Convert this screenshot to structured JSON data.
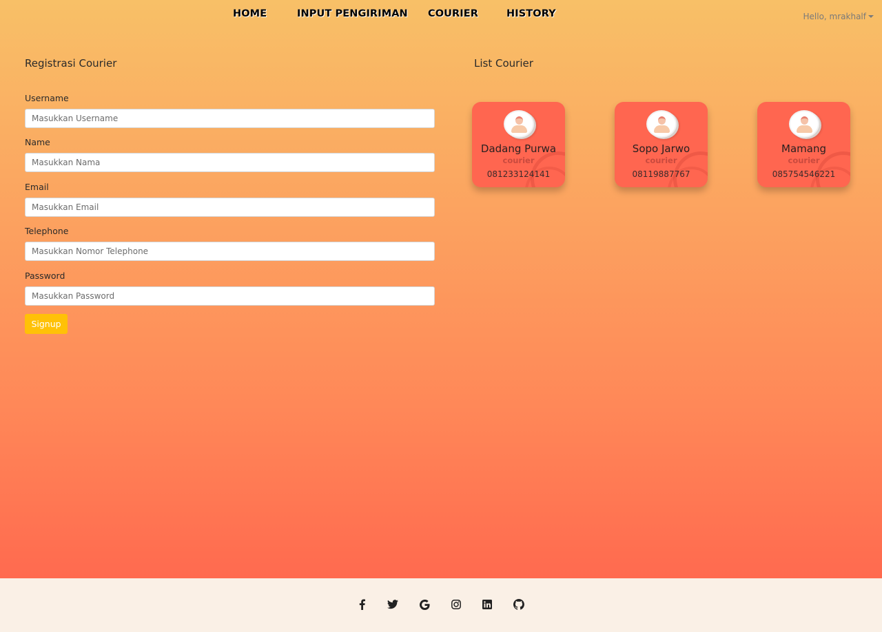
{
  "nav": {
    "items": [
      "HOME",
      "INPUT PENGIRIMAN",
      "COURIER",
      "HISTORY"
    ],
    "user_greeting": "Hello, mrakhalf"
  },
  "form": {
    "title": "Registrasi Courier",
    "fields": [
      {
        "label": "Username",
        "placeholder": "Masukkan Username",
        "value": ""
      },
      {
        "label": "Name",
        "placeholder": "Masukkan Nama",
        "value": ""
      },
      {
        "label": "Email",
        "placeholder": "Masukkan Email",
        "value": ""
      },
      {
        "label": "Telephone",
        "placeholder": "Masukkan Nomor Telephone",
        "value": ""
      },
      {
        "label": "Password",
        "placeholder": "Masukkan Password",
        "value": ""
      }
    ],
    "submit_label": "Signup"
  },
  "couriers": {
    "title": "List Courier",
    "items": [
      {
        "name": "Dadang Purwa",
        "role": "courier",
        "phone": "081233124141"
      },
      {
        "name": "Sopo Jarwo",
        "role": "courier",
        "phone": "08119887767"
      },
      {
        "name": "Mamang",
        "role": "courier",
        "phone": "085754546221"
      }
    ]
  },
  "footer": {
    "social_icons": [
      "facebook-icon",
      "twitter-icon",
      "google-icon",
      "instagram-icon",
      "linkedin-icon",
      "github-icon"
    ]
  },
  "colors": {
    "gradient_top": "#f8c067",
    "gradient_bottom": "#ff6a4f",
    "card": "#ff6650",
    "button": "#ffc107",
    "footer_bg": "#faf0e6"
  }
}
